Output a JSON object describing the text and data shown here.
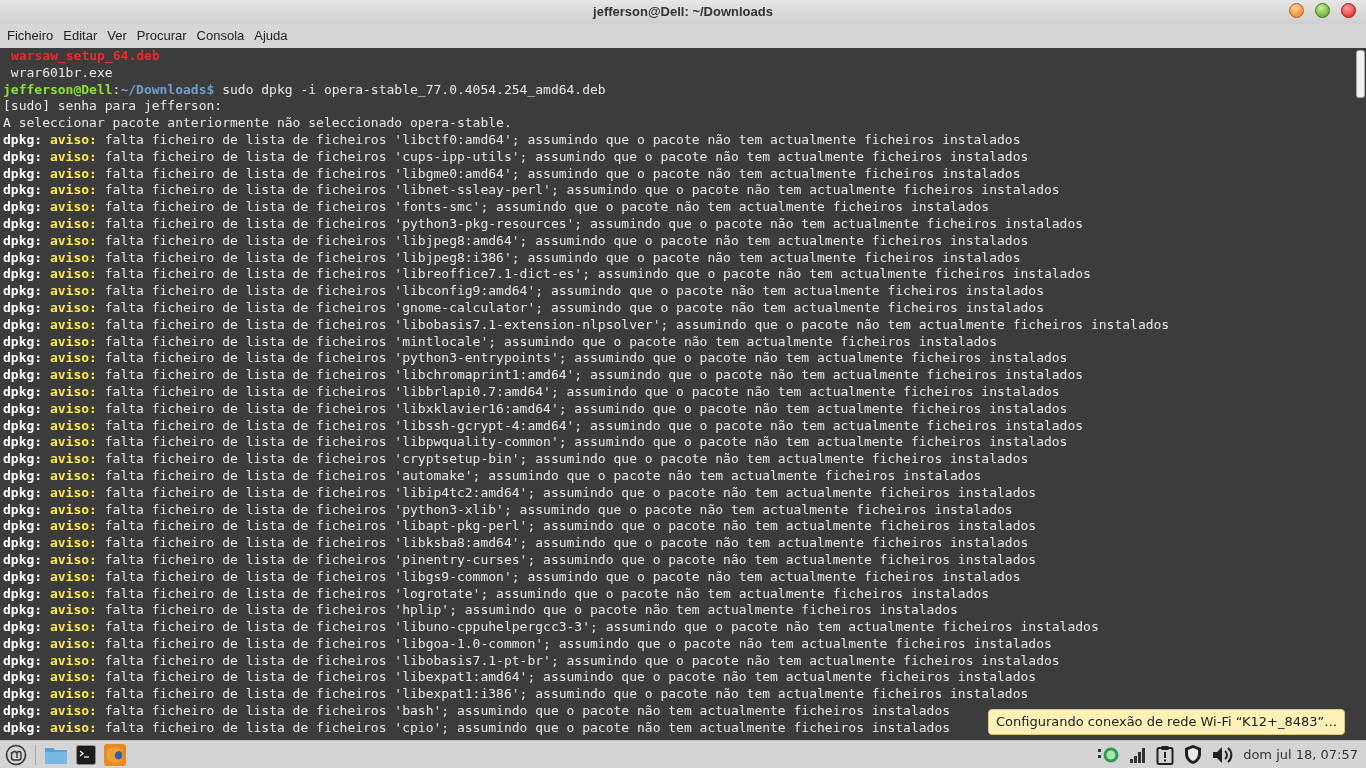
{
  "window": {
    "title": "jefferson@Dell: ~/Downloads"
  },
  "menu": [
    "Ficheiro",
    "Editar",
    "Ver",
    "Procurar",
    "Consola",
    "Ajuda"
  ],
  "terminal": {
    "lines": [
      {
        "kind": "error",
        "text": "warsaw_setup_64.deb"
      },
      {
        "kind": "plain",
        "text": " wrar601br.exe"
      },
      {
        "kind": "prompt",
        "user": "jefferson@Dell",
        "separator": ":",
        "path": "~/Downloads$",
        "command": "sudo dpkg -i opera-stable_77.0.4054.254_amd64.deb"
      },
      {
        "kind": "plain",
        "text": "[sudo] senha para jefferson:"
      },
      {
        "kind": "plain",
        "text": "A seleccionar pacote anteriormente não seleccionado opera-stable."
      },
      {
        "kind": "warning",
        "source": "dpkg:",
        "tag": "aviso:",
        "text": "falta ficheiro de lista de ficheiros 'libctf0:amd64'; assumindo que o pacote não tem actualmente ficheiros instalados"
      },
      {
        "kind": "warning",
        "source": "dpkg:",
        "tag": "aviso:",
        "text": "falta ficheiro de lista de ficheiros 'cups-ipp-utils'; assumindo que o pacote não tem actualmente ficheiros instalados"
      },
      {
        "kind": "warning",
        "source": "dpkg:",
        "tag": "aviso:",
        "text": "falta ficheiro de lista de ficheiros 'libgme0:amd64'; assumindo que o pacote não tem actualmente ficheiros instalados"
      },
      {
        "kind": "warning",
        "source": "dpkg:",
        "tag": "aviso:",
        "text": "falta ficheiro de lista de ficheiros 'libnet-ssleay-perl'; assumindo que o pacote não tem actualmente ficheiros instalados"
      },
      {
        "kind": "warning",
        "source": "dpkg:",
        "tag": "aviso:",
        "text": "falta ficheiro de lista de ficheiros 'fonts-smc'; assumindo que o pacote não tem actualmente ficheiros instalados"
      },
      {
        "kind": "warning",
        "source": "dpkg:",
        "tag": "aviso:",
        "text": "falta ficheiro de lista de ficheiros 'python3-pkg-resources'; assumindo que o pacote não tem actualmente ficheiros instalados"
      },
      {
        "kind": "warning",
        "source": "dpkg:",
        "tag": "aviso:",
        "text": "falta ficheiro de lista de ficheiros 'libjpeg8:amd64'; assumindo que o pacote não tem actualmente ficheiros instalados"
      },
      {
        "kind": "warning",
        "source": "dpkg:",
        "tag": "aviso:",
        "text": "falta ficheiro de lista de ficheiros 'libjpeg8:i386'; assumindo que o pacote não tem actualmente ficheiros instalados"
      },
      {
        "kind": "warning",
        "source": "dpkg:",
        "tag": "aviso:",
        "text": "falta ficheiro de lista de ficheiros 'libreoffice7.1-dict-es'; assumindo que o pacote não tem actualmente ficheiros instalados"
      },
      {
        "kind": "warning",
        "source": "dpkg:",
        "tag": "aviso:",
        "text": "falta ficheiro de lista de ficheiros 'libconfig9:amd64'; assumindo que o pacote não tem actualmente ficheiros instalados"
      },
      {
        "kind": "warning",
        "source": "dpkg:",
        "tag": "aviso:",
        "text": "falta ficheiro de lista de ficheiros 'gnome-calculator'; assumindo que o pacote não tem actualmente ficheiros instalados"
      },
      {
        "kind": "warning",
        "source": "dpkg:",
        "tag": "aviso:",
        "text": "falta ficheiro de lista de ficheiros 'libobasis7.1-extension-nlpsolver'; assumindo que o pacote não tem actualmente ficheiros instalados"
      },
      {
        "kind": "warning",
        "source": "dpkg:",
        "tag": "aviso:",
        "text": "falta ficheiro de lista de ficheiros 'mintlocale'; assumindo que o pacote não tem actualmente ficheiros instalados"
      },
      {
        "kind": "warning",
        "source": "dpkg:",
        "tag": "aviso:",
        "text": "falta ficheiro de lista de ficheiros 'python3-entrypoints'; assumindo que o pacote não tem actualmente ficheiros instalados"
      },
      {
        "kind": "warning",
        "source": "dpkg:",
        "tag": "aviso:",
        "text": "falta ficheiro de lista de ficheiros 'libchromaprint1:amd64'; assumindo que o pacote não tem actualmente ficheiros instalados"
      },
      {
        "kind": "warning",
        "source": "dpkg:",
        "tag": "aviso:",
        "text": "falta ficheiro de lista de ficheiros 'libbrlapi0.7:amd64'; assumindo que o pacote não tem actualmente ficheiros instalados"
      },
      {
        "kind": "warning",
        "source": "dpkg:",
        "tag": "aviso:",
        "text": "falta ficheiro de lista de ficheiros 'libxklavier16:amd64'; assumindo que o pacote não tem actualmente ficheiros instalados"
      },
      {
        "kind": "warning",
        "source": "dpkg:",
        "tag": "aviso:",
        "text": "falta ficheiro de lista de ficheiros 'libssh-gcrypt-4:amd64'; assumindo que o pacote não tem actualmente ficheiros instalados"
      },
      {
        "kind": "warning",
        "source": "dpkg:",
        "tag": "aviso:",
        "text": "falta ficheiro de lista de ficheiros 'libpwquality-common'; assumindo que o pacote não tem actualmente ficheiros instalados"
      },
      {
        "kind": "warning",
        "source": "dpkg:",
        "tag": "aviso:",
        "text": "falta ficheiro de lista de ficheiros 'cryptsetup-bin'; assumindo que o pacote não tem actualmente ficheiros instalados"
      },
      {
        "kind": "warning",
        "source": "dpkg:",
        "tag": "aviso:",
        "text": "falta ficheiro de lista de ficheiros 'automake'; assumindo que o pacote não tem actualmente ficheiros instalados"
      },
      {
        "kind": "warning",
        "source": "dpkg:",
        "tag": "aviso:",
        "text": "falta ficheiro de lista de ficheiros 'libip4tc2:amd64'; assumindo que o pacote não tem actualmente ficheiros instalados"
      },
      {
        "kind": "warning",
        "source": "dpkg:",
        "tag": "aviso:",
        "text": "falta ficheiro de lista de ficheiros 'python3-xlib'; assumindo que o pacote não tem actualmente ficheiros instalados"
      },
      {
        "kind": "warning",
        "source": "dpkg:",
        "tag": "aviso:",
        "text": "falta ficheiro de lista de ficheiros 'libapt-pkg-perl'; assumindo que o pacote não tem actualmente ficheiros instalados"
      },
      {
        "kind": "warning",
        "source": "dpkg:",
        "tag": "aviso:",
        "text": "falta ficheiro de lista de ficheiros 'libksba8:amd64'; assumindo que o pacote não tem actualmente ficheiros instalados"
      },
      {
        "kind": "warning",
        "source": "dpkg:",
        "tag": "aviso:",
        "text": "falta ficheiro de lista de ficheiros 'pinentry-curses'; assumindo que o pacote não tem actualmente ficheiros instalados"
      },
      {
        "kind": "warning",
        "source": "dpkg:",
        "tag": "aviso:",
        "text": "falta ficheiro de lista de ficheiros 'libgs9-common'; assumindo que o pacote não tem actualmente ficheiros instalados"
      },
      {
        "kind": "warning",
        "source": "dpkg:",
        "tag": "aviso:",
        "text": "falta ficheiro de lista de ficheiros 'logrotate'; assumindo que o pacote não tem actualmente ficheiros instalados"
      },
      {
        "kind": "warning",
        "source": "dpkg:",
        "tag": "aviso:",
        "text": "falta ficheiro de lista de ficheiros 'hplip'; assumindo que o pacote não tem actualmente ficheiros instalados"
      },
      {
        "kind": "warning",
        "source": "dpkg:",
        "tag": "aviso:",
        "text": "falta ficheiro de lista de ficheiros 'libuno-cppuhelpergcc3-3'; assumindo que o pacote não tem actualmente ficheiros instalados"
      },
      {
        "kind": "warning",
        "source": "dpkg:",
        "tag": "aviso:",
        "text": "falta ficheiro de lista de ficheiros 'libgoa-1.0-common'; assumindo que o pacote não tem actualmente ficheiros instalados"
      },
      {
        "kind": "warning",
        "source": "dpkg:",
        "tag": "aviso:",
        "text": "falta ficheiro de lista de ficheiros 'libobasis7.1-pt-br'; assumindo que o pacote não tem actualmente ficheiros instalados"
      },
      {
        "kind": "warning",
        "source": "dpkg:",
        "tag": "aviso:",
        "text": "falta ficheiro de lista de ficheiros 'libexpat1:amd64'; assumindo que o pacote não tem actualmente ficheiros instalados"
      },
      {
        "kind": "warning",
        "source": "dpkg:",
        "tag": "aviso:",
        "text": "falta ficheiro de lista de ficheiros 'libexpat1:i386'; assumindo que o pacote não tem actualmente ficheiros instalados"
      },
      {
        "kind": "warning",
        "source": "dpkg:",
        "tag": "aviso:",
        "text": "falta ficheiro de lista de ficheiros 'bash'; assumindo que o pacote não tem actualmente ficheiros instalados"
      },
      {
        "kind": "warning",
        "source": "dpkg:",
        "tag": "aviso:",
        "text": "falta ficheiro de lista de ficheiros 'cpio'; assumindo que o pacote não tem actualmente ficheiros instalados"
      }
    ]
  },
  "notification": {
    "text": "Configurando conexão de rede Wi-Fi “K12+_8483”…"
  },
  "taskbar": {
    "clock": "dom jul 18, 07:57"
  }
}
